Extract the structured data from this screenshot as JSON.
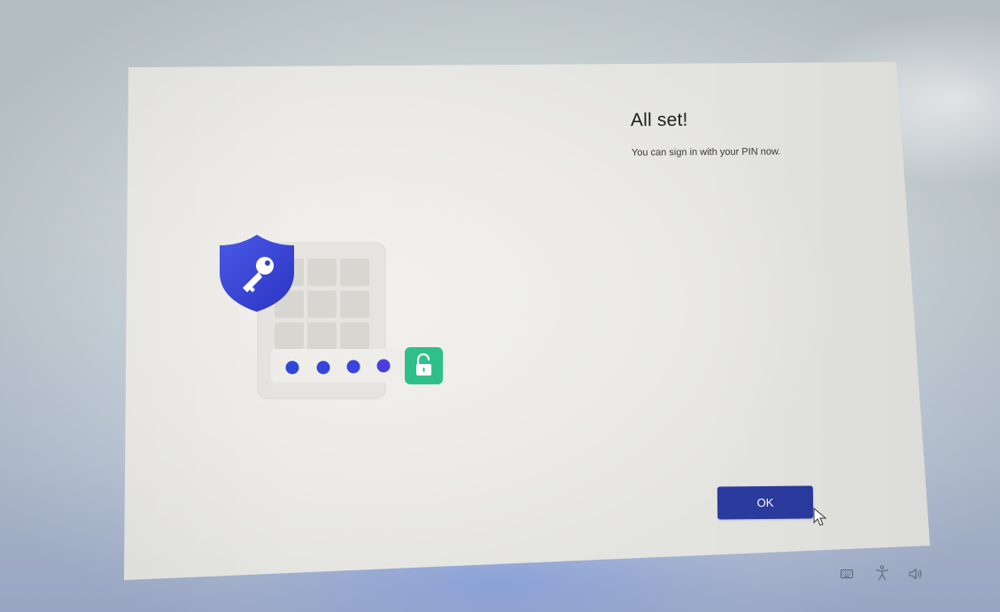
{
  "dialog": {
    "title": "All set!",
    "message": "You can sign in with your PIN now.",
    "ok_label": "OK"
  },
  "illustration": {
    "icons": [
      "shield-key-icon",
      "pin-keypad-icon",
      "pin-dot-icon",
      "unlocked-padlock-icon"
    ],
    "pin_dots": 4
  },
  "system_tray": {
    "icons": [
      "keyboard-icon",
      "accessibility-icon",
      "volume-icon"
    ]
  },
  "colors": {
    "accent": "#2b3a9e",
    "shield": "#3a47d6",
    "pin_dot": "#3f43e0",
    "unlock_badge": "#2fbf8a"
  }
}
